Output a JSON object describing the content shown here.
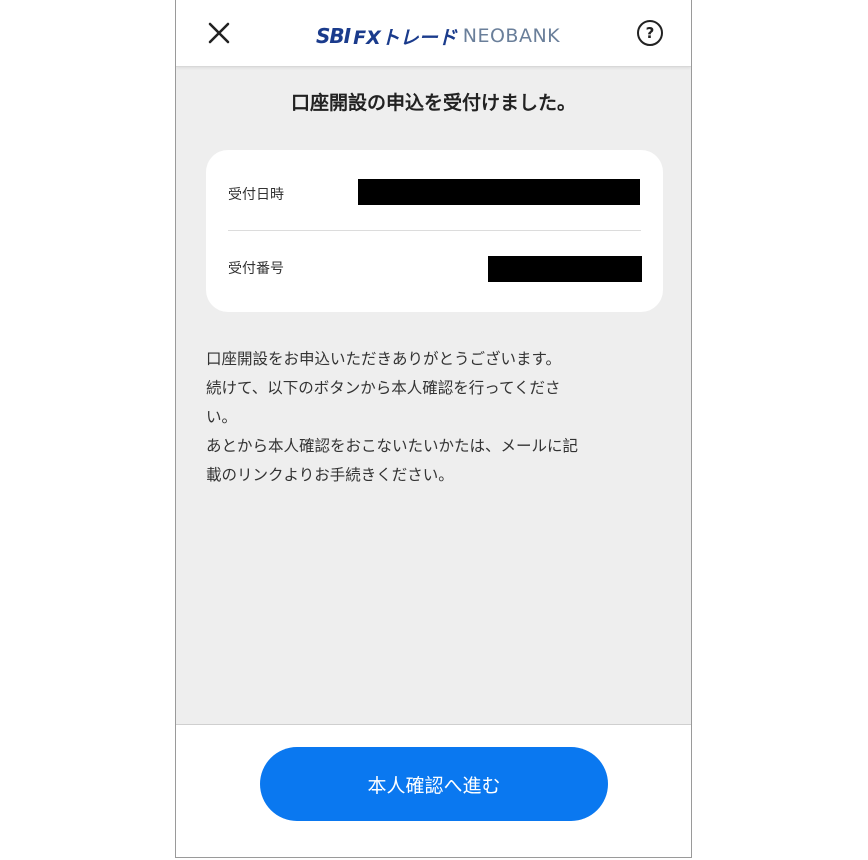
{
  "header": {
    "logo_sbi": "SBI",
    "logo_fx": "FXトレード",
    "logo_neo": "NEOBANK",
    "help_label": "?"
  },
  "title": "口座開設の申込を受付けました。",
  "receipt": {
    "date_label": "受付日時",
    "number_label": "受付番号"
  },
  "message": "口座開設をお申込いただきありがとうございます。\n続けて、以下のボタンから本人確認を行ってくださ\nい。\nあとから本人確認をおこないたいかたは、メールに記\n載のリンクよりお手続きください。",
  "footer": {
    "button_label": "本人確認へ進む"
  },
  "colors": {
    "primary": "#0a78f0",
    "brand": "#1a3b8c",
    "background": "#eeeeee"
  }
}
